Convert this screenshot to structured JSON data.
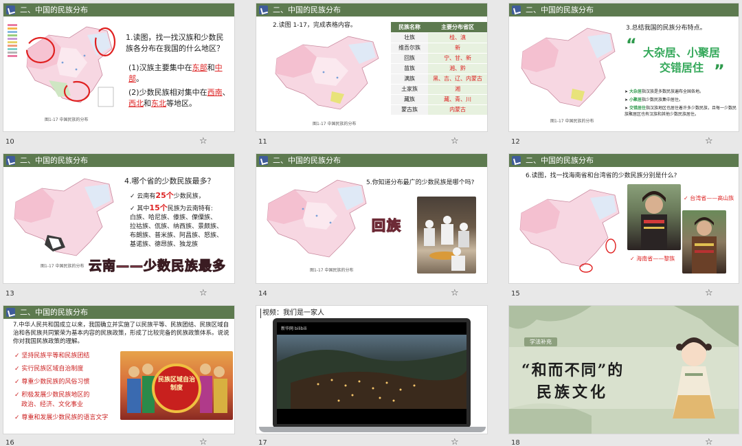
{
  "section_title": "二、中国的民族分布",
  "map_caption": "图1-17 中国民族的分布",
  "slides": [
    {
      "num": "10",
      "q_title": "1.读图，找一找汉族和少数民族各分布在我国的什么地区？",
      "q1_pre": "(1)汉族主要集中在",
      "q1_a1": "东部",
      "q1_mid": "和",
      "q1_a2": "中部",
      "q1_end": "。",
      "q2_pre": "(2)少数民族相对集中在",
      "q2_a1": "西南",
      "q2_sep": "、",
      "q2_a2": "西北",
      "q2_mid": "和",
      "q2_a3": "东北",
      "q2_end": "等地区。"
    },
    {
      "num": "11",
      "q_title": "2.读图 1-17，完成表格内容。",
      "table_headers": [
        "民族名称",
        "主要分布省区"
      ],
      "table_rows": [
        [
          "壮族",
          "桂、滇"
        ],
        [
          "维吾尔族",
          "新"
        ],
        [
          "回族",
          "宁、甘、新"
        ],
        [
          "苗族",
          "湘、黔"
        ],
        [
          "满族",
          "黑、吉、辽、内蒙古"
        ],
        [
          "土家族",
          "湘"
        ],
        [
          "藏族",
          "藏、青、川"
        ],
        [
          "蒙古族",
          "内蒙古"
        ]
      ]
    },
    {
      "num": "12",
      "q_title": "3.总结我国的民族分布特点。",
      "quote_l1": "大杂居、小聚居",
      "quote_l2": "交错居住",
      "b1_key": "大杂居",
      "b1_text": "指汉族是多数民族遍布全国各地。",
      "b2_key": "小聚居",
      "b2_text": "指少数民族集中居住。",
      "b3_key": "交错居住",
      "b3_text": "指汉族地区也居住着许多少数民族，且每一少数民族聚居区也有汉族和其他少数民族居住。"
    },
    {
      "num": "13",
      "q_title": "4.哪个省的少数民族最多？",
      "l1_pre": "云南有",
      "l1_num": "25个",
      "l1_post": "少数民族，",
      "l2_pre": "其中",
      "l2_num": "15个",
      "l2_post": "民族为云南特有:",
      "l3": "白族、哈尼族、傣族、傈僳族、",
      "l4": "拉祜族、佤族、纳西族、景颇族、",
      "l5": "布朗族、普米族、阿昌族、怒族、",
      "l6": "基诺族、德昂族、独龙族",
      "banner": "云南——少数民族最多"
    },
    {
      "num": "14",
      "q_title": "5.你知道分布最广的少数民族是哪个吗?",
      "answer": "回族"
    },
    {
      "num": "15",
      "q_title": "6.读图，找一找海南省和台湾省的少数民族分别是什么?",
      "taiwan": "台湾省——高山族",
      "hainan": "海南省——黎族"
    },
    {
      "num": "16",
      "q_title": "7.中华人民共和国成立以来，我国确立并实施了以民族平等、民族团结、民族区域自治和各民族共同繁荣为基本内容的民族政策，形成了比较完备的民族政策体系。说说你对我国民族政策的理解。",
      "items": [
        "坚持民族平等和民族团结",
        "实行民族区域自治制度",
        "尊重少数民族的风俗习惯",
        "积极发展少数民族地区的",
        "政治、经济、文化事业",
        "尊重和发展少数民族的语言文字"
      ],
      "badge": "民族区域自治制度"
    },
    {
      "num": "17",
      "title": "视频：我们是一家人",
      "screen_logo": "新华网 bilibili"
    },
    {
      "num": "18",
      "tag": "学法补充",
      "title_l1": "“和而不同”的",
      "title_l2": "民族文化"
    }
  ]
}
